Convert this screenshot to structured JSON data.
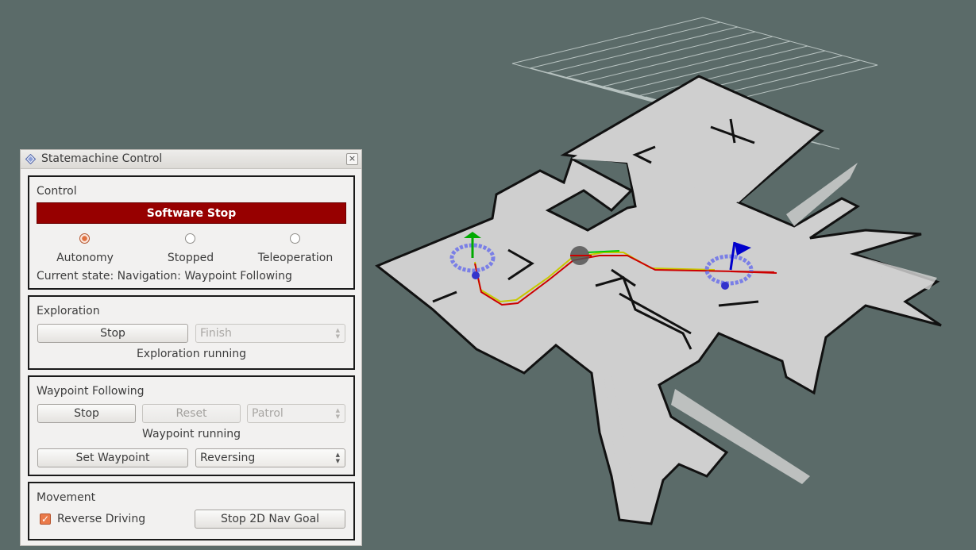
{
  "panel": {
    "title": "Statemachine Control",
    "close": "×",
    "control": {
      "title": "Control",
      "software_stop": "Software Stop",
      "modes": [
        {
          "label": "Autonomy",
          "checked": true
        },
        {
          "label": "Stopped",
          "checked": false
        },
        {
          "label": "Teleoperation",
          "checked": false
        }
      ],
      "current_state": "Current state: Navigation: Waypoint Following"
    },
    "exploration": {
      "title": "Exploration",
      "stop": "Stop",
      "finish": "Finish",
      "status": "Exploration running"
    },
    "waypoint": {
      "title": "Waypoint Following",
      "stop": "Stop",
      "reset": "Reset",
      "patrol": "Patrol",
      "status": "Waypoint running",
      "set_waypoint": "Set Waypoint",
      "mode": "Reversing"
    },
    "movement": {
      "title": "Movement",
      "reverse_driving": "Reverse Driving",
      "reverse_checked": true,
      "stop_nav_goal": "Stop 2D Nav Goal"
    }
  },
  "scene": {
    "background": "#5b6b69",
    "map_free": "#cfcfcf",
    "map_wall": "#111111",
    "grid": "#b7c2c0",
    "goal_flag": "#0000cc",
    "start_flag": "#00aa00",
    "path_colors": [
      "#cc0000",
      "#00cc00",
      "#c8c800"
    ],
    "robot_marker": "#555555"
  }
}
